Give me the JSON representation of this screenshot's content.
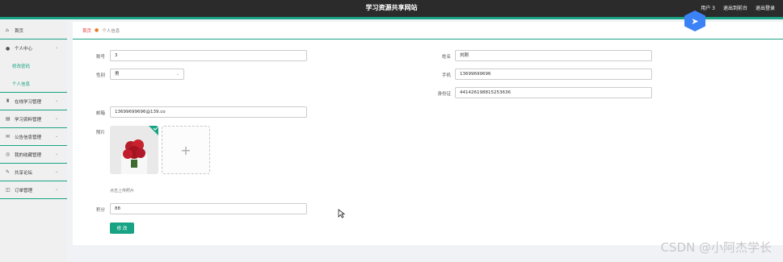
{
  "header": {
    "title": "学习资源共享网站",
    "user": "用户 3",
    "backend": "退出到前台",
    "logout": "退出登录"
  },
  "sidebar": {
    "items": [
      {
        "label": "首页"
      },
      {
        "label": "个人中心"
      },
      {
        "label": "在线学习管理"
      },
      {
        "label": "学习资料管理"
      },
      {
        "label": "公告信息管理"
      },
      {
        "label": "我的收藏管理"
      },
      {
        "label": "共享论坛"
      },
      {
        "label": "订单管理"
      }
    ],
    "subitems": [
      {
        "label": "修改密码"
      },
      {
        "label": "个人信息"
      }
    ]
  },
  "breadcrumb": {
    "home": "首页",
    "current": "个人信息"
  },
  "form": {
    "account": {
      "label": "账号",
      "value": "3"
    },
    "gender": {
      "label": "性别",
      "value": "男"
    },
    "email": {
      "label": "邮箱",
      "value": "13699699696@139.co"
    },
    "photo_label": "照片",
    "upload_hint": "点击上传照片",
    "upload_plus": "+",
    "points": {
      "label": "积分",
      "value": "88"
    },
    "name": {
      "label": "姓名",
      "value": "刘刚"
    },
    "phone": {
      "label": "手机",
      "value": "13699699696"
    },
    "idcard": {
      "label": "身份证",
      "value": "441426198815253636"
    },
    "submit": "修 改"
  },
  "watermark": "CSDN @小阿杰学长",
  "colors": {
    "accent": "#19a385",
    "topbar": "#2b2b2b"
  },
  "icons": [
    "home-icon",
    "user-icon",
    "book-icon",
    "folder-icon",
    "mail-icon",
    "star-icon",
    "forum-icon",
    "order-icon",
    "chevron-down-icon"
  ]
}
